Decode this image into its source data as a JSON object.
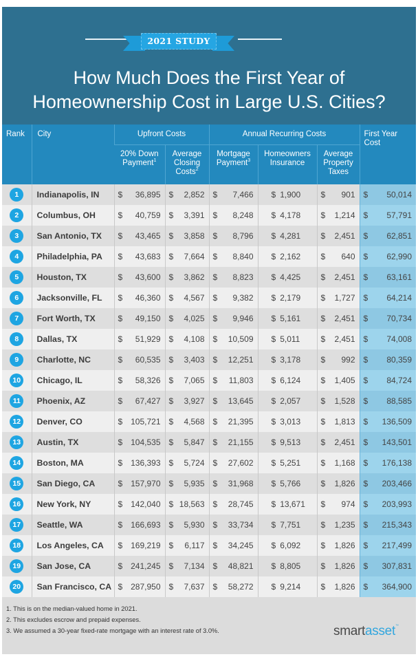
{
  "banner": {
    "ribbon_label": "2021 STUDY",
    "title_line1": "How Much Does the First Year of",
    "title_line2": "Homeownership Cost in Large U.S. Cities?"
  },
  "table": {
    "headers": {
      "rank": "Rank",
      "city": "City",
      "upfront_group": "Upfront Costs",
      "annual_group": "Annual Recurring Costs",
      "first_year": "First Year Cost",
      "down_payment": "20% Down Payment",
      "down_payment_sup": "1",
      "closing_costs": "Average Closing Costs",
      "closing_costs_sup": "2",
      "mortgage": "Mortgage Payment",
      "mortgage_sup": "3",
      "insurance": "Homeowners Insurance",
      "property_taxes": "Average Property Taxes"
    },
    "currency_symbol": "$",
    "rows": [
      {
        "rank": "1",
        "city": "Indianapolis, IN",
        "down": "36,895",
        "closing": "2,852",
        "mortgage": "7,466",
        "insurance": "1,900",
        "taxes": "901",
        "first_year": "50,014"
      },
      {
        "rank": "2",
        "city": "Columbus, OH",
        "down": "40,759",
        "closing": "3,391",
        "mortgage": "8,248",
        "insurance": "4,178",
        "taxes": "1,214",
        "first_year": "57,791"
      },
      {
        "rank": "3",
        "city": "San Antonio, TX",
        "down": "43,465",
        "closing": "3,858",
        "mortgage": "8,796",
        "insurance": "4,281",
        "taxes": "2,451",
        "first_year": "62,851"
      },
      {
        "rank": "4",
        "city": "Philadelphia, PA",
        "down": "43,683",
        "closing": "7,664",
        "mortgage": "8,840",
        "insurance": "2,162",
        "taxes": "640",
        "first_year": "62,990"
      },
      {
        "rank": "5",
        "city": "Houston, TX",
        "down": "43,600",
        "closing": "3,862",
        "mortgage": "8,823",
        "insurance": "4,425",
        "taxes": "2,451",
        "first_year": "63,161"
      },
      {
        "rank": "6",
        "city": "Jacksonville, FL",
        "down": "46,360",
        "closing": "4,567",
        "mortgage": "9,382",
        "insurance": "2,179",
        "taxes": "1,727",
        "first_year": "64,214"
      },
      {
        "rank": "7",
        "city": "Fort Worth, TX",
        "down": "49,150",
        "closing": "4,025",
        "mortgage": "9,946",
        "insurance": "5,161",
        "taxes": "2,451",
        "first_year": "70,734"
      },
      {
        "rank": "8",
        "city": "Dallas, TX",
        "down": "51,929",
        "closing": "4,108",
        "mortgage": "10,509",
        "insurance": "5,011",
        "taxes": "2,451",
        "first_year": "74,008"
      },
      {
        "rank": "9",
        "city": "Charlotte, NC",
        "down": "60,535",
        "closing": "3,403",
        "mortgage": "12,251",
        "insurance": "3,178",
        "taxes": "992",
        "first_year": "80,359"
      },
      {
        "rank": "10",
        "city": "Chicago, IL",
        "down": "58,326",
        "closing": "7,065",
        "mortgage": "11,803",
        "insurance": "6,124",
        "taxes": "1,405",
        "first_year": "84,724"
      },
      {
        "rank": "11",
        "city": "Phoenix, AZ",
        "down": "67,427",
        "closing": "3,927",
        "mortgage": "13,645",
        "insurance": "2,057",
        "taxes": "1,528",
        "first_year": "88,585"
      },
      {
        "rank": "12",
        "city": "Denver, CO",
        "down": "105,721",
        "closing": "4,568",
        "mortgage": "21,395",
        "insurance": "3,013",
        "taxes": "1,813",
        "first_year": "136,509"
      },
      {
        "rank": "13",
        "city": "Austin, TX",
        "down": "104,535",
        "closing": "5,847",
        "mortgage": "21,155",
        "insurance": "9,513",
        "taxes": "2,451",
        "first_year": "143,501"
      },
      {
        "rank": "14",
        "city": "Boston, MA",
        "down": "136,393",
        "closing": "5,724",
        "mortgage": "27,602",
        "insurance": "5,251",
        "taxes": "1,168",
        "first_year": "176,138"
      },
      {
        "rank": "15",
        "city": "San Diego, CA",
        "down": "157,970",
        "closing": "5,935",
        "mortgage": "31,968",
        "insurance": "5,766",
        "taxes": "1,826",
        "first_year": "203,466"
      },
      {
        "rank": "16",
        "city": "New York, NY",
        "down": "142,040",
        "closing": "18,563",
        "mortgage": "28,745",
        "insurance": "13,671",
        "taxes": "974",
        "first_year": "203,993"
      },
      {
        "rank": "17",
        "city": "Seattle, WA",
        "down": "166,693",
        "closing": "5,930",
        "mortgage": "33,734",
        "insurance": "7,751",
        "taxes": "1,235",
        "first_year": "215,343"
      },
      {
        "rank": "18",
        "city": "Los Angeles, CA",
        "down": "169,219",
        "closing": "6,117",
        "mortgage": "34,245",
        "insurance": "6,092",
        "taxes": "1,826",
        "first_year": "217,499"
      },
      {
        "rank": "19",
        "city": "San Jose, CA",
        "down": "241,245",
        "closing": "7,134",
        "mortgage": "48,821",
        "insurance": "8,805",
        "taxes": "1,826",
        "first_year": "307,831"
      },
      {
        "rank": "20",
        "city": "San Francisco, CA",
        "down": "287,950",
        "closing": "7,637",
        "mortgage": "58,272",
        "insurance": "9,214",
        "taxes": "1,826",
        "first_year": "364,900"
      }
    ]
  },
  "footer": {
    "notes": [
      "1. This is on the median-valued home in 2021.",
      "2. This excludes escrow and prepaid expenses.",
      "3. We assumed a 30-year fixed-rate mortgage with an interest rate of 3.0%."
    ],
    "logo_part1": "smart",
    "logo_part2": "asset",
    "logo_tm": "™"
  },
  "colors": {
    "banner_bg": "#2e7090",
    "header_bg": "#2389be",
    "ribbon": "#25a6e3",
    "rank_badge": "#1ea5e2",
    "first_year_col": "#9dd4ec",
    "row_dark": "#dedede",
    "row_light": "#efefef"
  }
}
